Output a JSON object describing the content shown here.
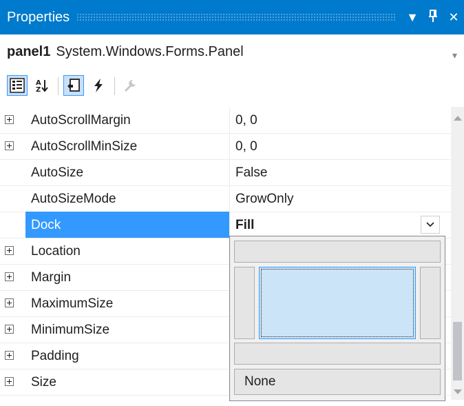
{
  "window": {
    "title": "Properties",
    "buttons": {
      "dropdown": "▼",
      "pin": "⊥",
      "close": "✕"
    }
  },
  "object": {
    "name": "panel1",
    "type": "System.Windows.Forms.Panel"
  },
  "toolbar": {
    "tools": [
      {
        "name": "categorized-icon",
        "checked": true
      },
      {
        "name": "alphabetical-icon",
        "checked": false
      },
      {
        "name": "properties-icon",
        "checked": true
      },
      {
        "name": "events-icon",
        "checked": false
      },
      {
        "name": "property-pages-icon",
        "checked": false,
        "disabled": true
      }
    ]
  },
  "properties": [
    {
      "name": "AutoScrollMargin",
      "value": "0, 0",
      "expandable": true
    },
    {
      "name": "AutoScrollMinSize",
      "value": "0, 0",
      "expandable": true
    },
    {
      "name": "AutoSize",
      "value": "False",
      "expandable": false
    },
    {
      "name": "AutoSizeMode",
      "value": "GrowOnly",
      "expandable": false
    },
    {
      "name": "Dock",
      "value": "Fill",
      "expandable": false,
      "selected": true
    },
    {
      "name": "Location",
      "value": "",
      "expandable": true
    },
    {
      "name": "Margin",
      "value": "",
      "expandable": true
    },
    {
      "name": "MaximumSize",
      "value": "",
      "expandable": true
    },
    {
      "name": "MinimumSize",
      "value": "",
      "expandable": true
    },
    {
      "name": "Padding",
      "value": "",
      "expandable": true
    },
    {
      "name": "Size",
      "value": "",
      "expandable": true
    }
  ],
  "dock_picker": {
    "options": [
      "Top",
      "Left",
      "Fill",
      "Right",
      "Bottom"
    ],
    "selected": "Fill",
    "none_label": "None"
  },
  "colors": {
    "accent": "#007acc",
    "selection": "#3399ff",
    "fill_highlight": "#cce4f7"
  }
}
